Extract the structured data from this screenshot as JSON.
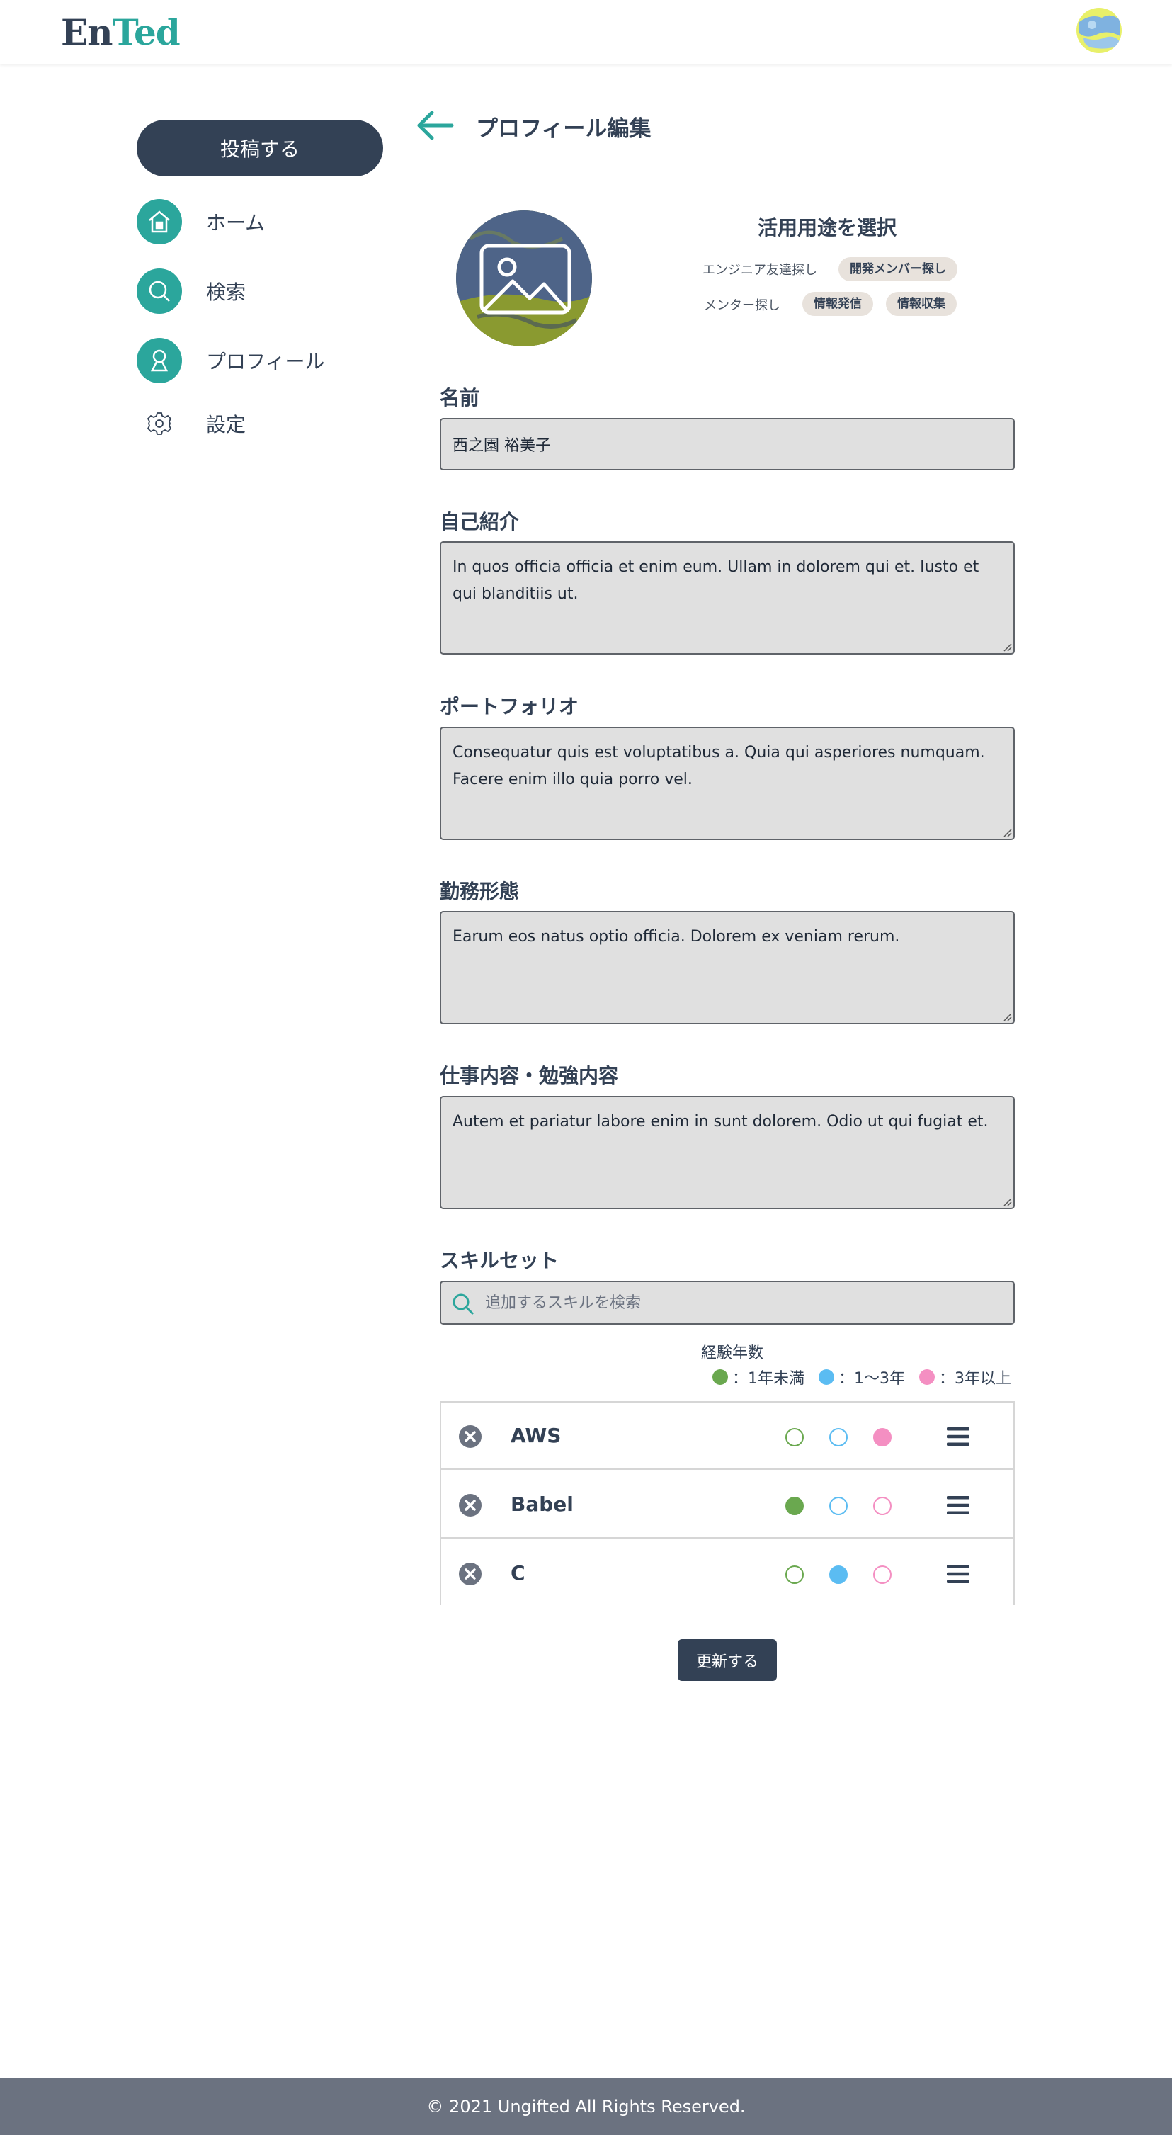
{
  "header": {
    "logo_en": "En",
    "logo_ted": "Ted"
  },
  "sidebar": {
    "post_button": "投稿する",
    "items": [
      {
        "label": "ホーム",
        "icon": "home-icon"
      },
      {
        "label": "検索",
        "icon": "search-icon"
      },
      {
        "label": "プロフィール",
        "icon": "profile-icon"
      },
      {
        "label": "設定",
        "icon": "gear-icon"
      }
    ]
  },
  "page": {
    "title": "プロフィール編集"
  },
  "purpose": {
    "title": "活用用途を選択",
    "rows": [
      {
        "label": "エンジニア友達探し",
        "tags": [
          "開発メンバー探し"
        ]
      },
      {
        "label": "メンター探し",
        "tags": [
          "情報発信",
          "情報収集"
        ]
      }
    ]
  },
  "form": {
    "name_label": "名前",
    "name_value": "西之園 裕美子",
    "intro_label": "自己紹介",
    "intro_value": "In quos officia officia et enim eum. Ullam in dolorem qui et. Iusto et qui blanditiis ut.",
    "portfolio_label": "ポートフォリオ",
    "portfolio_value": "Consequatur quis est voluptatibus a. Quia qui asperiores numquam. Facere enim illo quia porro vel.",
    "work_style_label": "勤務形態",
    "work_style_value": "Earum eos natus optio officia. Dolorem ex veniam rerum.",
    "work_content_label": "仕事内容・勉強内容",
    "work_content_value": "Autem et pariatur labore enim in sunt dolorem. Odio ut qui fugiat et."
  },
  "skills": {
    "label": "スキルセット",
    "search_placeholder": "追加するスキルを検索",
    "experience_title": "経験年数",
    "legend": [
      {
        "label": "：1年未満",
        "color": "#6aa84f"
      },
      {
        "label": "：1〜3年",
        "color": "#5bbcf2"
      },
      {
        "label": "：3年以上",
        "color": "#f48fc2"
      }
    ],
    "items": [
      {
        "name": "AWS",
        "level": 3
      },
      {
        "name": "Babel",
        "level": 1
      },
      {
        "name": "C",
        "level": 2
      }
    ]
  },
  "update_button": "更新する",
  "footer": {
    "copyright": "© 2021 Ungifted All Rights Reserved."
  },
  "colors": {
    "primary": "#334155",
    "accent": "#2ba69c",
    "level_1": "#6aa84f",
    "level_2": "#5bbcf2",
    "level_3": "#f48fc2"
  }
}
